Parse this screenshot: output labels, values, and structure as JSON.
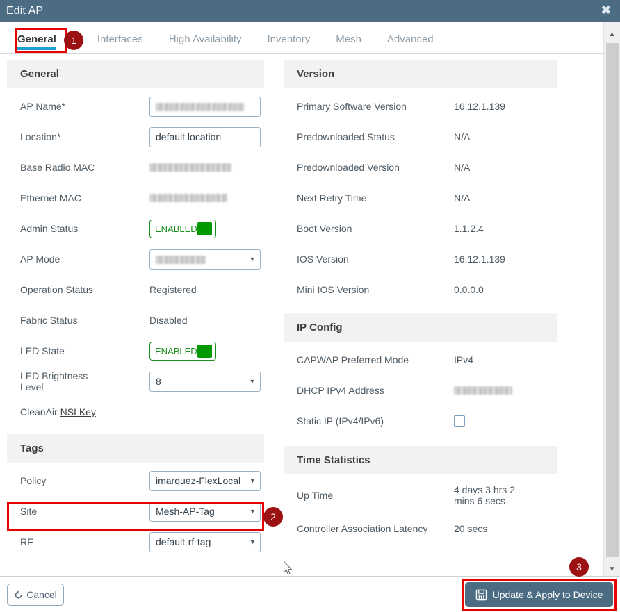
{
  "window": {
    "title": "Edit AP",
    "close_icon": "close-icon"
  },
  "tabs": [
    {
      "label": "General",
      "active": true
    },
    {
      "label": "Interfaces",
      "active": false
    },
    {
      "label": "High Availability",
      "active": false
    },
    {
      "label": "Inventory",
      "active": false
    },
    {
      "label": "Mesh",
      "active": false
    },
    {
      "label": "Advanced",
      "active": false
    }
  ],
  "callouts": [
    {
      "number": "1"
    },
    {
      "number": "2"
    },
    {
      "number": "3"
    }
  ],
  "sections": {
    "general": {
      "header": "General",
      "ap_name": {
        "label": "AP Name*",
        "value": "",
        "redacted": true
      },
      "location": {
        "label": "Location*",
        "value": "default location"
      },
      "base_radio_mac": {
        "label": "Base Radio MAC",
        "value": "",
        "redacted": true
      },
      "ethernet_mac": {
        "label": "Ethernet MAC",
        "value": "",
        "redacted": true
      },
      "admin_status": {
        "label": "Admin Status",
        "value": "ENABLED"
      },
      "ap_mode": {
        "label": "AP Mode",
        "value": "",
        "redacted": true
      },
      "operation_status": {
        "label": "Operation Status",
        "value": "Registered"
      },
      "fabric_status": {
        "label": "Fabric Status",
        "value": "Disabled"
      },
      "led_state": {
        "label": "LED State",
        "value": "ENABLED"
      },
      "led_brightness": {
        "label": "LED Brightness Level",
        "value": "8"
      },
      "cleanair": {
        "label": "CleanAir ",
        "link": "NSI Key"
      }
    },
    "tags": {
      "header": "Tags",
      "policy": {
        "label": "Policy",
        "value": "imarquez-FlexLocal"
      },
      "site": {
        "label": "Site",
        "value": "Mesh-AP-Tag"
      },
      "rf": {
        "label": "RF",
        "value": "default-rf-tag"
      }
    },
    "version": {
      "header": "Version",
      "rows": [
        {
          "label": "Primary Software Version",
          "value": "16.12.1.139"
        },
        {
          "label": "Predownloaded Status",
          "value": "N/A"
        },
        {
          "label": "Predownloaded Version",
          "value": "N/A"
        },
        {
          "label": "Next Retry Time",
          "value": "N/A"
        },
        {
          "label": "Boot Version",
          "value": "1.1.2.4"
        },
        {
          "label": "IOS Version",
          "value": "16.12.1.139"
        },
        {
          "label": "Mini IOS Version",
          "value": "0.0.0.0"
        }
      ]
    },
    "ip_config": {
      "header": "IP Config",
      "capwap": {
        "label": "CAPWAP Preferred Mode",
        "value": "IPv4"
      },
      "dhcp": {
        "label": "DHCP IPv4 Address",
        "value": "",
        "redacted": true
      },
      "static_ip": {
        "label": "Static IP (IPv4/IPv6)",
        "checked": false
      }
    },
    "time_statistics": {
      "header": "Time Statistics",
      "uptime": {
        "label": "Up Time",
        "value": "4 days 3 hrs 2 mins 6 secs"
      },
      "latency": {
        "label": "Controller Association Latency",
        "value": "20 secs"
      }
    }
  },
  "footer": {
    "cancel": "Cancel",
    "cancel_icon": "undo-icon",
    "apply": "Update & Apply to Device",
    "apply_icon": "save-icon"
  },
  "colors": {
    "titlebar": "#4c6c84",
    "accent_tab": "#1ba0d7",
    "highlight": "#e60000",
    "badge": "#9c1111",
    "toggle_green": "#009900",
    "primary_button": "#4c6c84"
  }
}
